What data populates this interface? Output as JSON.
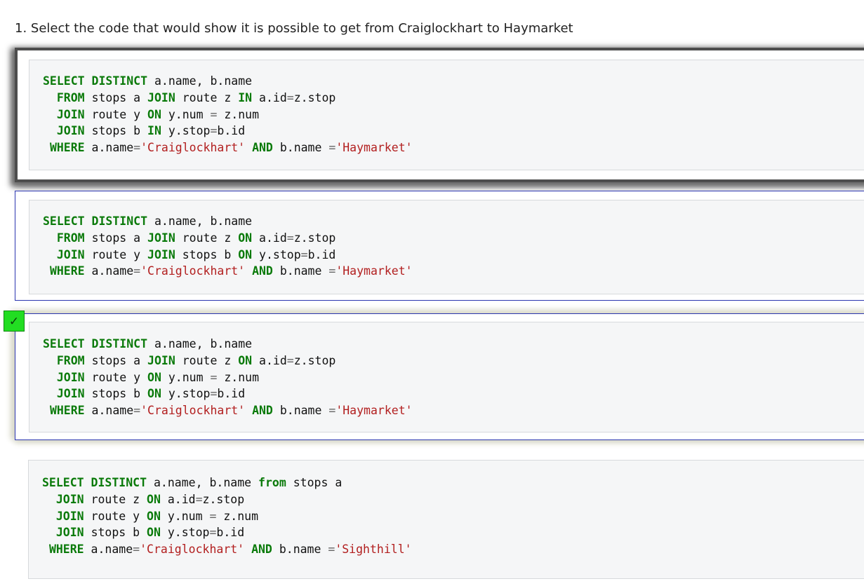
{
  "question": {
    "text": "1. Select the code that would show it is possible to get from Craiglockhart to Haymarket"
  },
  "correct_marker": {
    "symbol": "✓",
    "color": "#22dd22"
  },
  "options": [
    {
      "lines": [
        "SELECT DISTINCT a.name, b.name",
        "  FROM stops a JOIN route z IN a.id=z.stop",
        "  JOIN route y ON y.num = z.num",
        "  JOIN stops b IN y.stop=b.id",
        " WHERE a.name='Craiglockhart' AND b.name ='Haymarket'"
      ]
    },
    {
      "lines": [
        "SELECT DISTINCT a.name, b.name",
        "  FROM stops a JOIN route z ON a.id=z.stop",
        "  JOIN route y JOIN stops b ON y.stop=b.id",
        " WHERE a.name='Craiglockhart' AND b.name ='Haymarket'"
      ]
    },
    {
      "lines": [
        "SELECT DISTINCT a.name, b.name",
        "  FROM stops a JOIN route z ON a.id=z.stop",
        "  JOIN route y ON y.num = z.num",
        "  JOIN stops b ON y.stop=b.id",
        " WHERE a.name='Craiglockhart' AND b.name ='Haymarket'"
      ]
    },
    {
      "lines": [
        "SELECT DISTINCT a.name, b.name from stops a",
        "  JOIN route z ON a.id=z.stop",
        "  JOIN route y ON y.num = z.num",
        "  JOIN stops b ON y.stop=b.id",
        " WHERE a.name='Craiglockhart' AND b.name ='Sighthill'"
      ]
    }
  ],
  "colors": {
    "keyword": "#0a7a0a",
    "string": "#b21f1f",
    "option_border": "#2a35b0"
  }
}
